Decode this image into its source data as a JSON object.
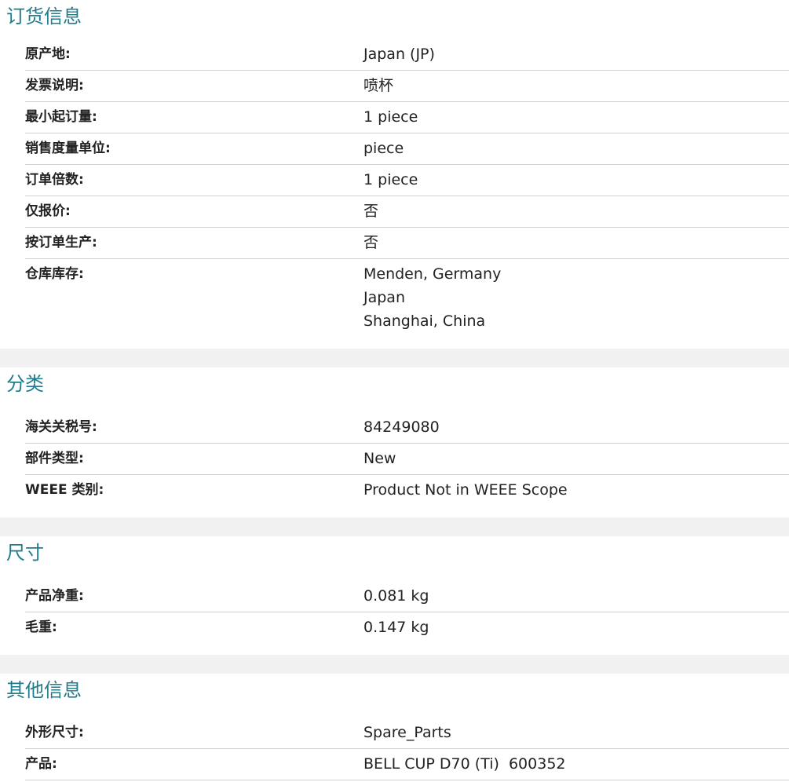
{
  "sections": [
    {
      "title": "订货信息",
      "rows": [
        {
          "label": "原产地:",
          "value": "Japan (JP)"
        },
        {
          "label": "发票说明:",
          "value": "喷杯"
        },
        {
          "label": "最小起订量:",
          "value": "1 piece"
        },
        {
          "label": "销售度量单位:",
          "value": "piece"
        },
        {
          "label": "订单倍数:",
          "value": "1 piece"
        },
        {
          "label": "仅报价:",
          "value": "否"
        },
        {
          "label": "按订单生产:",
          "value": "否"
        },
        {
          "label": "仓库库存:",
          "values": [
            "Menden, Germany",
            "Japan",
            "Shanghai, China"
          ]
        }
      ]
    },
    {
      "title": "分类",
      "rows": [
        {
          "label": "海关关税号:",
          "value": "84249080"
        },
        {
          "label": "部件类型:",
          "value": "New"
        },
        {
          "label": "WEEE 类别:",
          "value": "Product Not in WEEE Scope"
        }
      ]
    },
    {
      "title": "尺寸",
      "rows": [
        {
          "label": "产品净重:",
          "value": "0.081 kg"
        },
        {
          "label": "毛重:",
          "value": "0.147 kg"
        }
      ]
    },
    {
      "title": "其他信息",
      "rows": [
        {
          "label": "外形尺寸:",
          "value": "Spare_Parts"
        },
        {
          "label": "产品:",
          "value": "BELL CUP D70 (Ti)  600352"
        }
      ]
    }
  ],
  "colors": {
    "section_title": "#1f7c8c",
    "divider": "#d0d0d0",
    "gap_band": "#f1f1f1",
    "text": "#222222"
  }
}
